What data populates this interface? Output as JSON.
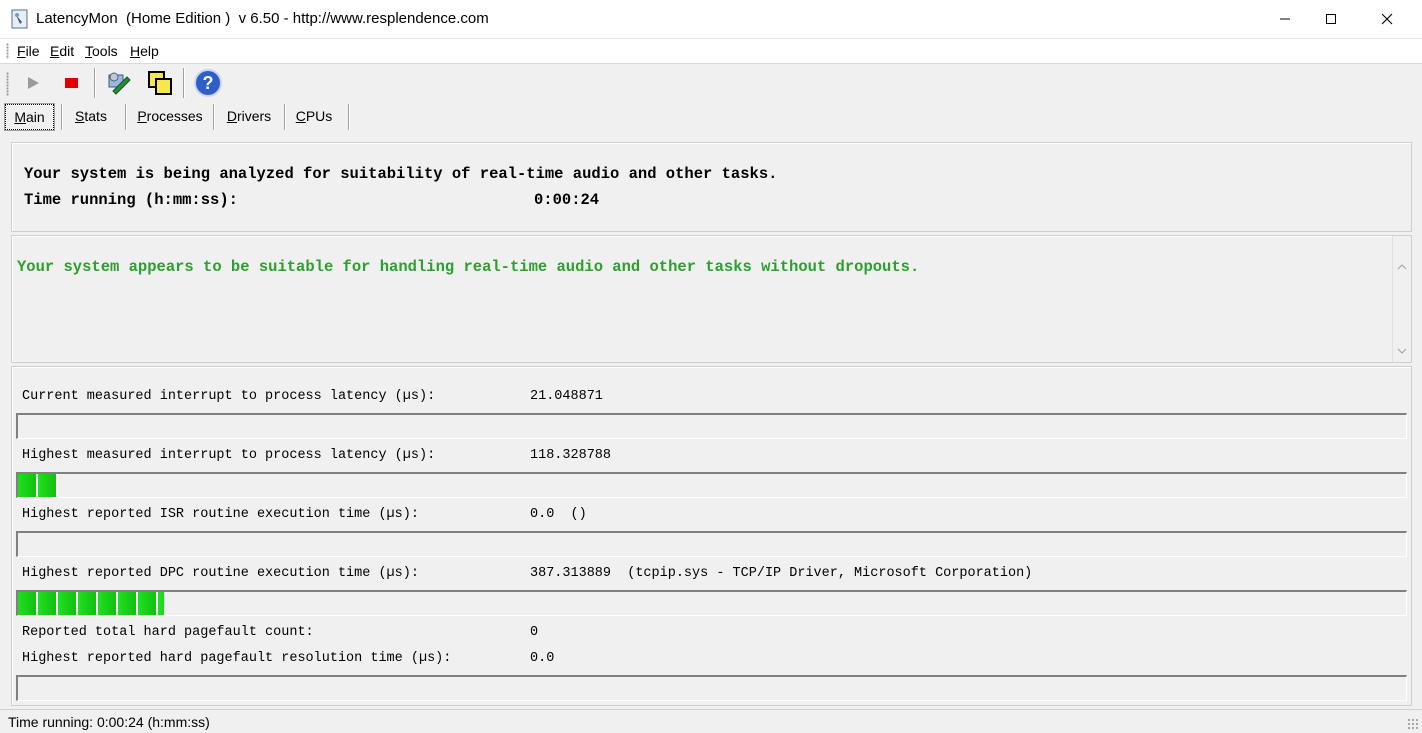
{
  "window": {
    "title": "LatencyMon  (Home Edition )  v 6.50 - http://www.resplendence.com"
  },
  "menu": {
    "items": [
      {
        "key": "F",
        "rest": "ile"
      },
      {
        "key": "E",
        "rest": "dit"
      },
      {
        "key": "T",
        "rest": "ools"
      },
      {
        "key": "H",
        "rest": "elp"
      }
    ]
  },
  "tabs": [
    {
      "key": "M",
      "rest": "ain"
    },
    {
      "key": "S",
      "rest": "tats"
    },
    {
      "key": "P",
      "rest": "rocesses"
    },
    {
      "key": "D",
      "rest": "rivers"
    },
    {
      "key": "C",
      "rest": "PUs"
    }
  ],
  "analysis": {
    "line1": "Your system is being analyzed for suitability of real-time audio and other tasks.",
    "time_label": "Time running (h:mm:ss):",
    "time_value": "0:00:24"
  },
  "verdict": {
    "text": "Your system appears to be suitable for handling real-time audio and other tasks without dropouts.",
    "color": "#2ca02c"
  },
  "measurements": [
    {
      "label": "Current measured interrupt to process latency (µs):",
      "value": "21.048871",
      "bar_fraction": 0.0
    },
    {
      "label": "Highest measured interrupt to process latency (µs):",
      "value": "118.328788",
      "bar_fraction": 0.029
    },
    {
      "label": "Highest reported ISR routine execution time (µs):",
      "value": "0.0  ()",
      "bar_fraction": 0.0
    },
    {
      "label": "Highest reported DPC routine execution time (µs):",
      "value": "387.313889  (tcpip.sys - TCP/IP Driver, Microsoft Corporation)",
      "bar_fraction": 0.105
    },
    {
      "label": "Reported total hard pagefault count:",
      "value": "0"
    },
    {
      "label": "Highest reported hard pagefault resolution time (µs):",
      "value": "0.0",
      "bar_fraction": 0.0
    }
  ],
  "statusbar": {
    "text": "Time running: 0:00:24  (h:mm:ss)"
  },
  "icons": {
    "app": "latencymon-app-icon",
    "play": "play-icon",
    "stop": "stop-icon",
    "tools": "tools-icon",
    "windows": "windows-icon",
    "help": "help-icon"
  },
  "colors": {
    "stop": "#e00000",
    "bar_green": "#20e020"
  }
}
